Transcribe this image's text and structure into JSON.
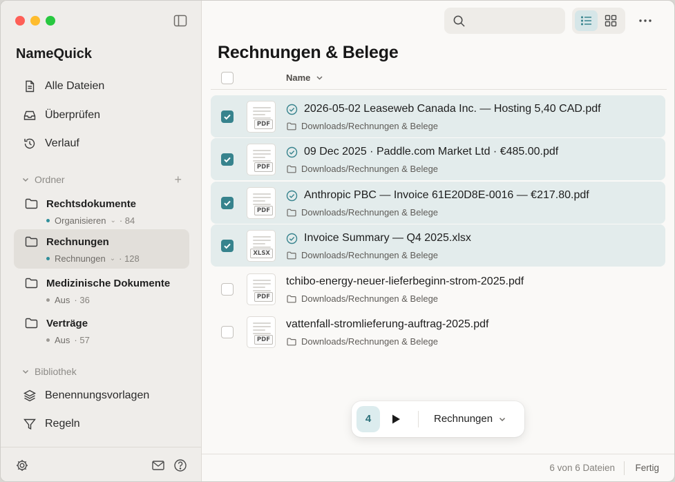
{
  "app": {
    "title": "NameQuick"
  },
  "sidebar": {
    "nav": [
      {
        "label": "Alle Dateien",
        "icon": "document-icon"
      },
      {
        "label": "Überprüfen",
        "icon": "inbox-tray-icon"
      },
      {
        "label": "Verlauf",
        "icon": "history-icon"
      }
    ],
    "folders_section": {
      "label": "Ordner",
      "add": "+"
    },
    "folders": [
      {
        "name": "Rechtsdokumente",
        "status": "Organisieren",
        "status_color": "#2f8e9a",
        "count": "· 84",
        "has_menu": true,
        "active": false
      },
      {
        "name": "Rechnungen",
        "status": "Rechnungen",
        "status_color": "#2f8e9a",
        "count": "· 128",
        "has_menu": true,
        "active": true
      },
      {
        "name": "Medizinische Dokumente",
        "status": "Aus",
        "status_color": "#9c9994",
        "count": "· 36",
        "has_menu": false,
        "active": false
      },
      {
        "name": "Verträge",
        "status": "Aus",
        "status_color": "#9c9994",
        "count": "· 57",
        "has_menu": false,
        "active": false
      }
    ],
    "library_section": {
      "label": "Bibliothek"
    },
    "library": [
      {
        "label": "Benennungsvorlagen",
        "icon": "layers-icon"
      },
      {
        "label": "Regeln",
        "icon": "filter-icon"
      }
    ]
  },
  "main": {
    "title": "Rechnungen & Belege",
    "column_name": "Name",
    "search_placeholder": "",
    "files": [
      {
        "name": "2026-05-02 Leaseweb Canada Inc. — Hosting 5,40 CAD.pdf",
        "path": "Downloads/Rechnungen & Belege",
        "type": "PDF",
        "selected": true,
        "renamed": true
      },
      {
        "name": "09 Dec 2025 · Paddle.com Market Ltd · €485.00.pdf",
        "path": "Downloads/Rechnungen & Belege",
        "type": "PDF",
        "selected": true,
        "renamed": true
      },
      {
        "name": "Anthropic PBC — Invoice 61E20D8E-0016 — €217.80.pdf",
        "path": "Downloads/Rechnungen & Belege",
        "type": "PDF",
        "selected": true,
        "renamed": true
      },
      {
        "name": "Invoice Summary — Q4 2025.xlsx",
        "path": "Downloads/Rechnungen & Belege",
        "type": "XLSX",
        "selected": true,
        "renamed": true
      },
      {
        "name": "tchibo-energy-neuer-lieferbeginn-strom-2025.pdf",
        "path": "Downloads/Rechnungen & Belege",
        "type": "PDF",
        "selected": false,
        "renamed": false
      },
      {
        "name": "vattenfall-stromlieferung-auftrag-2025.pdf",
        "path": "Downloads/Rechnungen & Belege",
        "type": "PDF",
        "selected": false,
        "renamed": false
      }
    ],
    "action_bar": {
      "count": "4",
      "destination": "Rechnungen"
    },
    "status": {
      "count_text": "6 von 6 Dateien",
      "state": "Fertig"
    }
  },
  "colors": {
    "accent": "#37838d",
    "selected_row": "#e3ecec"
  }
}
